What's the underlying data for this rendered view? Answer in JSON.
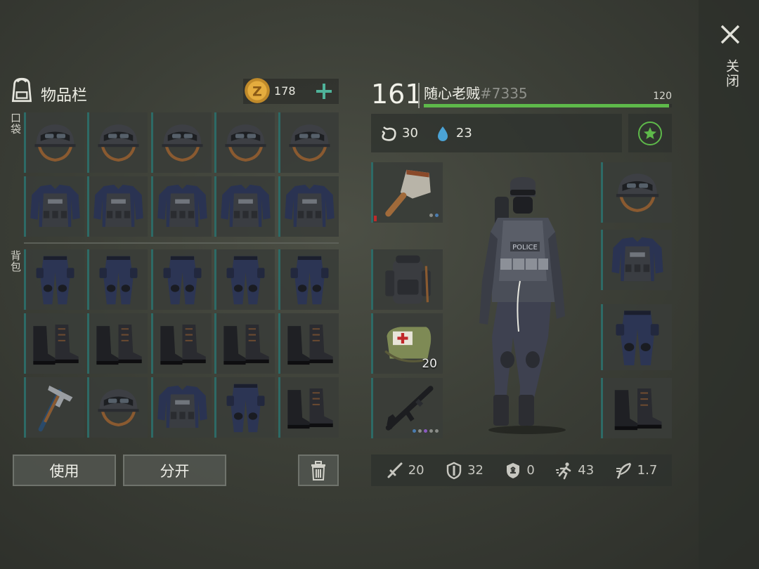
{
  "inventory": {
    "title": "物品栏",
    "coins": "178",
    "pocket_label": "口袋",
    "backpack_label": "背包",
    "grid": [
      [
        "helmet",
        "helmet",
        "helmet",
        "helmet",
        "helmet"
      ],
      [
        "vest",
        "vest",
        "vest",
        "vest",
        "vest"
      ],
      [
        "pants",
        "pants",
        "pants",
        "pants",
        "pants"
      ],
      [
        "boots",
        "boots",
        "boots",
        "boots",
        "boots"
      ],
      [
        "hammer",
        "helmet",
        "vest",
        "pants",
        "boots"
      ]
    ],
    "use_label": "使用",
    "split_label": "分开"
  },
  "player": {
    "level": "161",
    "name": "随心老贼",
    "tag": "#7335",
    "xp_value": "120",
    "xp_fraction": 0.99,
    "hunger": "30",
    "thirst": "23"
  },
  "equipment": {
    "left_slots": [
      "cleaver",
      "backpack",
      "medkit",
      "rifle"
    ],
    "medkit_count": "20",
    "right_slots": [
      "helmet",
      "vest",
      "pants",
      "boots"
    ]
  },
  "stats": {
    "attack": "20",
    "defense": "32",
    "radiation": "0",
    "speed": "43",
    "stealth": "1.7"
  },
  "close_label": "关闭",
  "colors": {
    "accent_green": "#5eb94a",
    "slot_border": "#2d6a66",
    "plus": "#4fb39a"
  }
}
